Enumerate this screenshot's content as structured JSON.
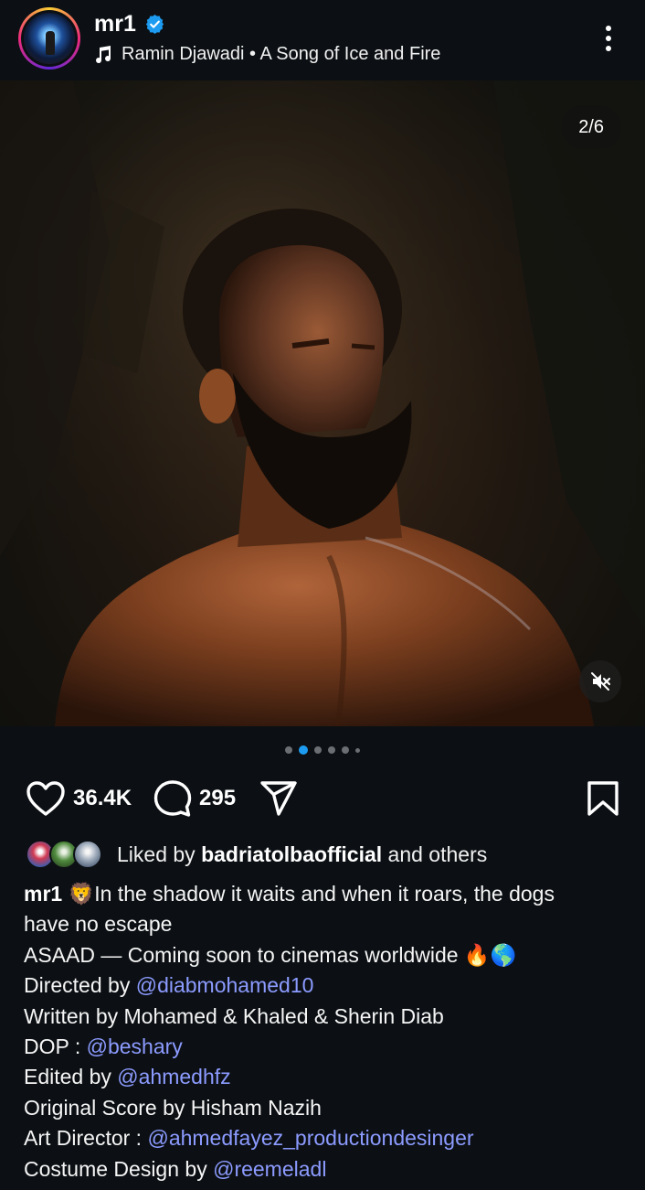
{
  "header": {
    "username": "mr1",
    "music_artist": "Ramin Djawadi",
    "music_separator": " • ",
    "music_title": "A Song of Ice and Fire",
    "icons": {
      "verified": "verified-badge-icon",
      "music": "music-note-icon",
      "more": "more-vertical-icon"
    }
  },
  "media": {
    "counter": "2/6",
    "mute_icon": "muted-speaker-icon",
    "current_index": 2,
    "total": 6
  },
  "actions": {
    "like_count": "36.4K",
    "comment_count": "295",
    "icons": {
      "like": "heart-icon",
      "comment": "comment-bubble-icon",
      "share": "send-icon",
      "save": "bookmark-icon"
    }
  },
  "liked_by": {
    "prefix": "Liked by",
    "user": "badriatolbaofficial",
    "suffix": "and others"
  },
  "caption": {
    "username": "mr1",
    "line1": "🦁In the shadow it waits and when it roars, the dogs",
    "line2": "have no escape",
    "line3": "ASAAD — Coming soon to cinemas worldwide 🔥🌎",
    "directed_label": "Directed by ",
    "directed_mention": "@diabmohamed10",
    "written": "Written by Mohamed & Khaled & Sherin Diab",
    "dop_label": "DOP : ",
    "dop_mention": "@beshary",
    "edited_label": "Edited by ",
    "edited_mention": "@ahmedhfz",
    "score": "Original Score by Hisham Nazih",
    "art_label": "Art Director : ",
    "art_mention": "@ahmedfayez_productiondesinger",
    "costume_label": "Costume Design by ",
    "costume_mention": "@reemeladl"
  },
  "colors": {
    "background": "#0c1014",
    "mention": "#8c9bff",
    "active_dot": "#1d9bf0",
    "verified": "#1d9bf0"
  }
}
